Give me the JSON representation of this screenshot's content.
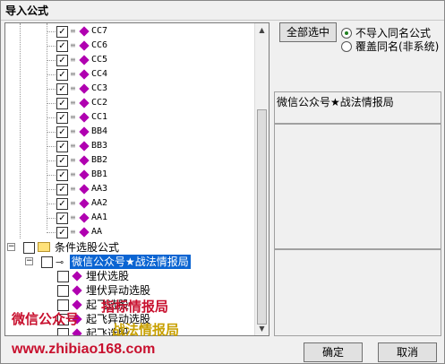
{
  "window": {
    "title": "导入公式"
  },
  "tree": {
    "leaves": [
      {
        "label": "CC7",
        "checked": true
      },
      {
        "label": "CC6",
        "checked": true
      },
      {
        "label": "CC5",
        "checked": true
      },
      {
        "label": "CC4",
        "checked": true
      },
      {
        "label": "CC3",
        "checked": true
      },
      {
        "label": "CC2",
        "checked": true
      },
      {
        "label": "CC1",
        "checked": true
      },
      {
        "label": "BB4",
        "checked": true
      },
      {
        "label": "BB3",
        "checked": true
      },
      {
        "label": "BB2",
        "checked": true
      },
      {
        "label": "BB1",
        "checked": true
      },
      {
        "label": "AA3",
        "checked": true
      },
      {
        "label": "AA2",
        "checked": true
      },
      {
        "label": "AA1",
        "checked": true
      },
      {
        "label": "AA",
        "checked": true
      }
    ],
    "folder": {
      "label": "条件选股公式",
      "expander": "−"
    },
    "subfolder": {
      "label": "微信公众号★战法情报局",
      "expander": "−"
    },
    "sub_items": [
      {
        "label": "埋伏选股"
      },
      {
        "label": "埋伏异动选股"
      },
      {
        "label": "起飞选股"
      },
      {
        "label": "起飞异动选股"
      },
      {
        "label": "起飞选股"
      }
    ]
  },
  "buttons": {
    "select_all": "全部选中",
    "confirm": "确定",
    "cancel": "取消"
  },
  "radios": [
    {
      "label": "不导入同名公式",
      "selected": true
    },
    {
      "label": "覆盖同名(非系统)",
      "selected": false
    }
  ],
  "description": "微信公众号★战法情报局",
  "watermarks": {
    "a": "微信公众号",
    "b": "指标情报局",
    "c": "战法情报局",
    "url": "www.zhibiao168.com"
  },
  "colors": {
    "selection": "#0a64d2",
    "diamond": "#b000b0",
    "watermark_red": "#c8102e",
    "watermark_gold": "#c8a000"
  }
}
